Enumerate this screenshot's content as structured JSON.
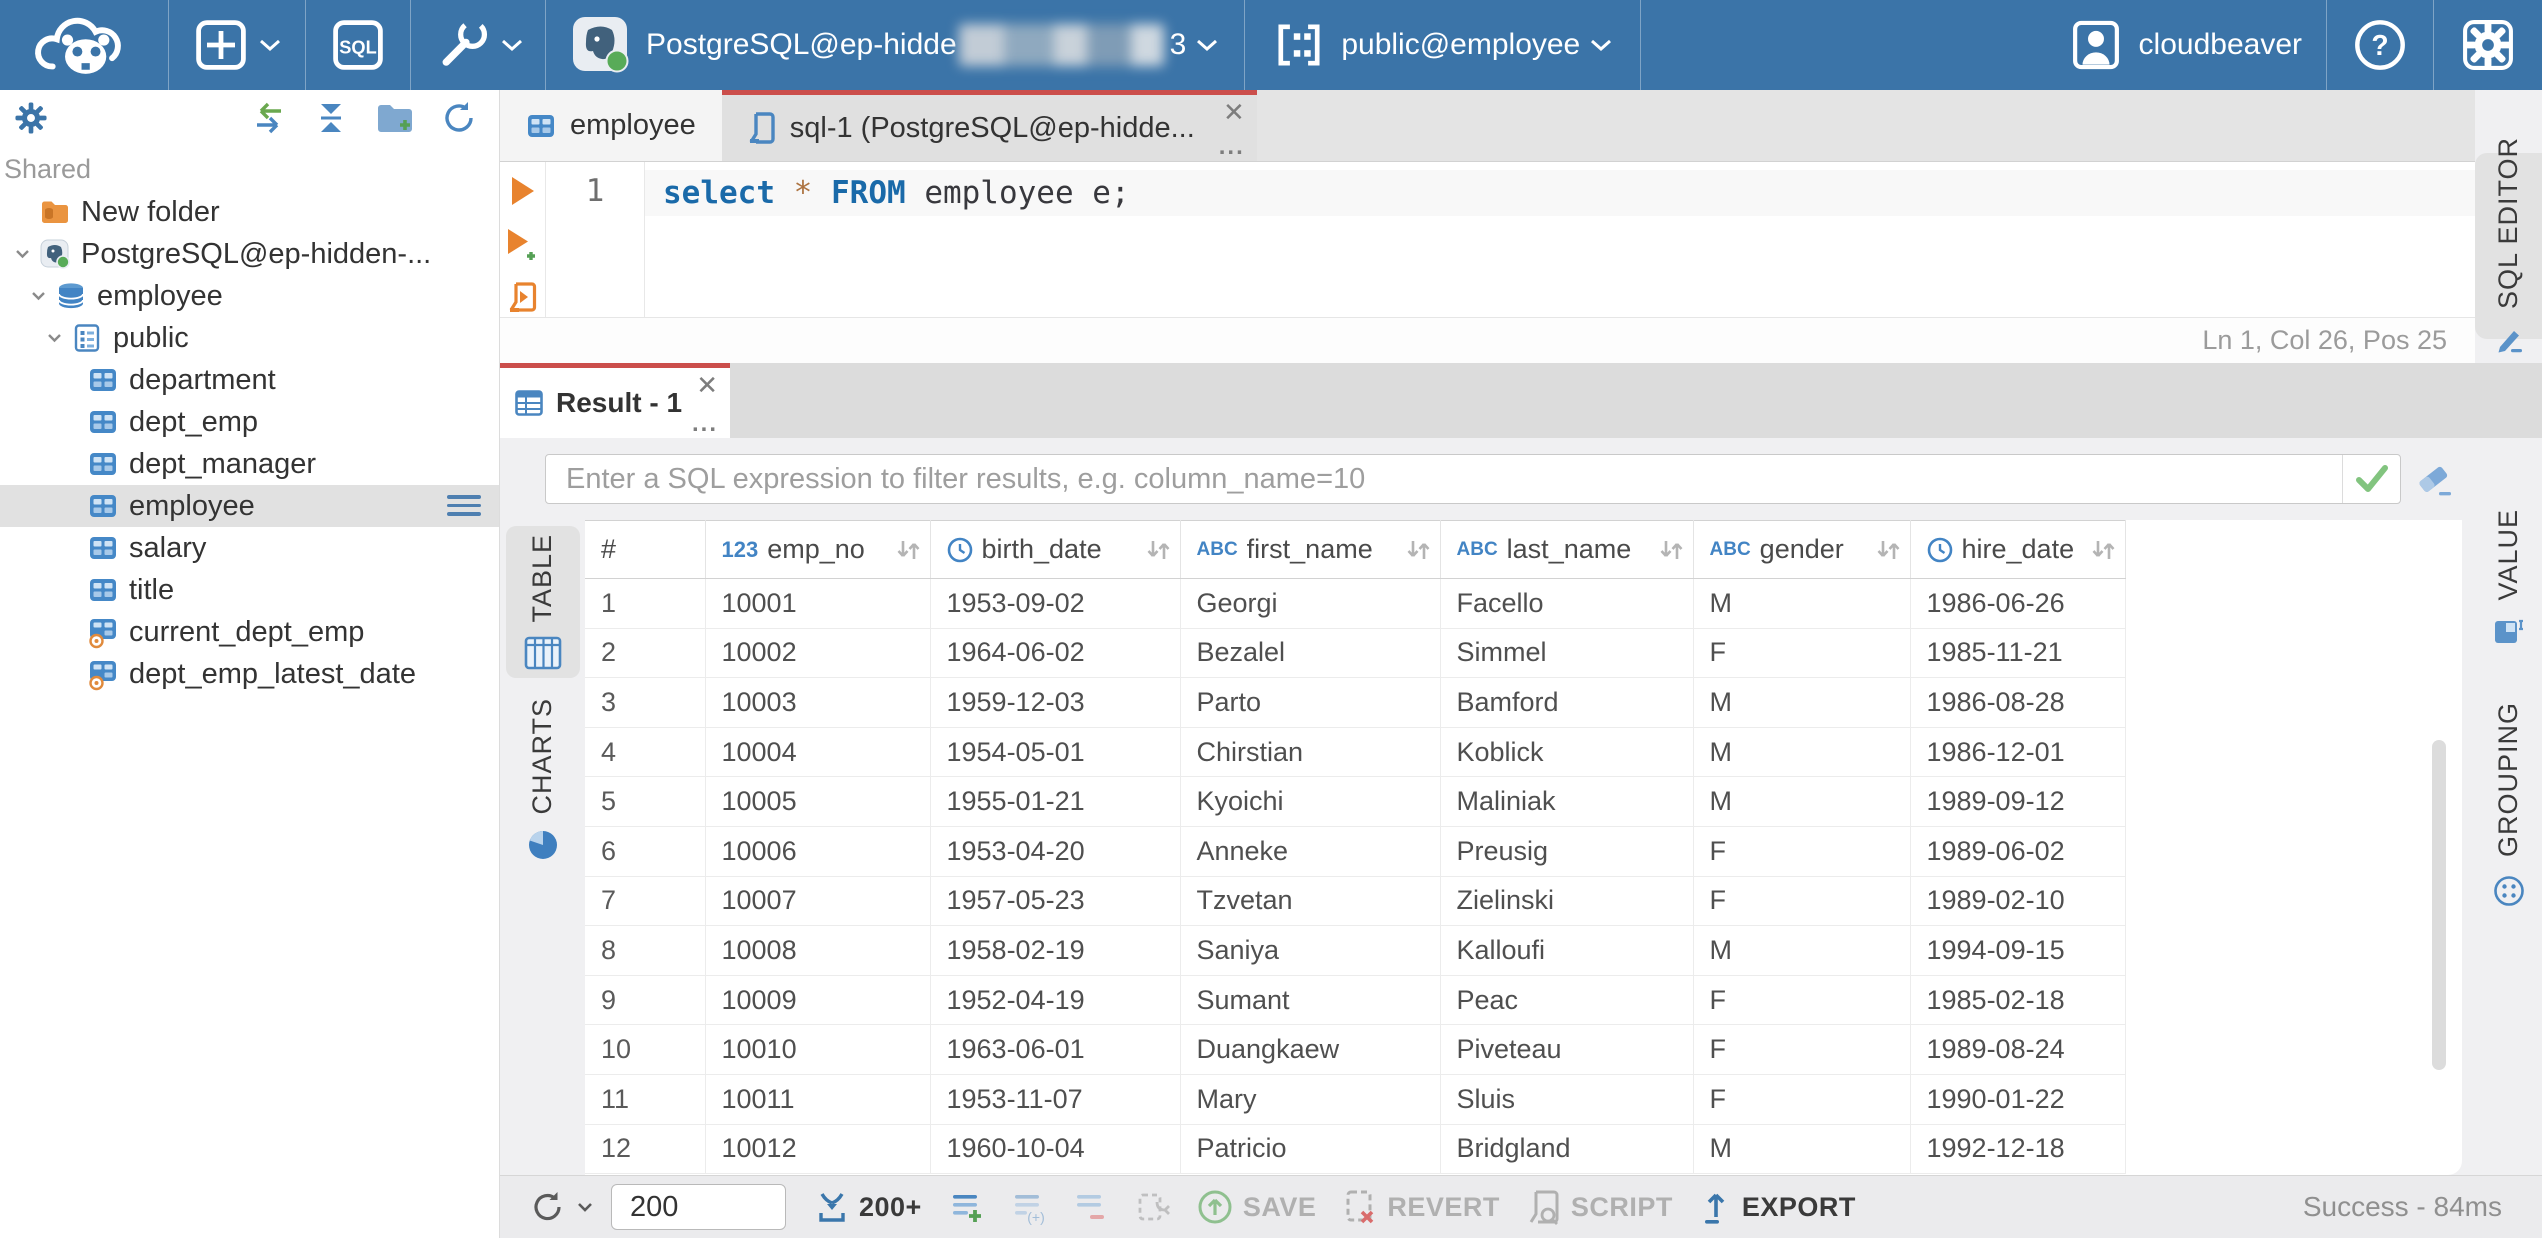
{
  "topbar": {
    "buttons": {
      "sql_label": "SQL"
    },
    "connection": {
      "label": "PostgreSQL@ep-hidde",
      "suffix": "3"
    },
    "schema": {
      "label": "public@employee"
    },
    "user": {
      "name": "cloudbeaver"
    }
  },
  "sidebar": {
    "shared_label": "Shared",
    "tree": [
      {
        "label": "New folder",
        "icon": "folder-db",
        "depth": 0,
        "chevron": false,
        "selected": false
      },
      {
        "label": "PostgreSQL@ep-hidden-...",
        "icon": "postgres",
        "depth": 0,
        "chevron": true,
        "selected": false
      },
      {
        "label": "employee",
        "icon": "database",
        "depth": 1,
        "chevron": true,
        "selected": false
      },
      {
        "label": "public",
        "icon": "schema",
        "depth": 2,
        "chevron": true,
        "selected": false
      },
      {
        "label": "department",
        "icon": "table",
        "depth": 3,
        "chevron": false,
        "selected": false
      },
      {
        "label": "dept_emp",
        "icon": "table",
        "depth": 3,
        "chevron": false,
        "selected": false
      },
      {
        "label": "dept_manager",
        "icon": "table",
        "depth": 3,
        "chevron": false,
        "selected": false
      },
      {
        "label": "employee",
        "icon": "table",
        "depth": 3,
        "chevron": false,
        "selected": true
      },
      {
        "label": "salary",
        "icon": "table",
        "depth": 3,
        "chevron": false,
        "selected": false
      },
      {
        "label": "title",
        "icon": "table",
        "depth": 3,
        "chevron": false,
        "selected": false
      },
      {
        "label": "current_dept_emp",
        "icon": "view",
        "depth": 3,
        "chevron": false,
        "selected": false
      },
      {
        "label": "dept_emp_latest_date",
        "icon": "view",
        "depth": 3,
        "chevron": false,
        "selected": false
      }
    ]
  },
  "editor_tabs": {
    "table_tab": "employee",
    "sql_tab": "sql-1 (PostgreSQL@ep-hidde..."
  },
  "sql_editor": {
    "line_number": "1",
    "tokens": [
      {
        "text": "select",
        "type": "keyword"
      },
      {
        "text": " ",
        "type": "plain"
      },
      {
        "text": "*",
        "type": "operator"
      },
      {
        "text": " ",
        "type": "plain"
      },
      {
        "text": "FROM",
        "type": "keyword"
      },
      {
        "text": " employee e;",
        "type": "plain"
      }
    ],
    "status": "Ln 1, Col 26, Pos 25"
  },
  "result": {
    "tab_label": "Result - 1",
    "filter_placeholder": "Enter a SQL expression to filter results, e.g. column_name=10",
    "left_tabs": [
      {
        "label": "TABLE",
        "icon": "table-grid",
        "active": true
      },
      {
        "label": "CHARTS",
        "icon": "pie-chart",
        "active": false
      }
    ],
    "right_tabs": [
      {
        "label": "SQL EDITOR",
        "icon": "sql-editor",
        "active": true,
        "slot": "rt-sqleditor"
      },
      {
        "label": "VALUE",
        "icon": "value-panel",
        "active": false,
        "slot": "rt-value"
      },
      {
        "label": "GROUPING",
        "icon": "grouping",
        "active": false,
        "slot": "rt-grouping"
      }
    ],
    "grid": {
      "columns": [
        {
          "label": "#",
          "type": "index"
        },
        {
          "label": "emp_no",
          "type": "number"
        },
        {
          "label": "birth_date",
          "type": "datetime"
        },
        {
          "label": "first_name",
          "type": "string"
        },
        {
          "label": "last_name",
          "type": "string"
        },
        {
          "label": "gender",
          "type": "string"
        },
        {
          "label": "hire_date",
          "type": "datetime"
        }
      ],
      "rows": [
        [
          "1",
          "10001",
          "1953-09-02",
          "Georgi",
          "Facello",
          "M",
          "1986-06-26"
        ],
        [
          "2",
          "10002",
          "1964-06-02",
          "Bezalel",
          "Simmel",
          "F",
          "1985-11-21"
        ],
        [
          "3",
          "10003",
          "1959-12-03",
          "Parto",
          "Bamford",
          "M",
          "1986-08-28"
        ],
        [
          "4",
          "10004",
          "1954-05-01",
          "Chirstian",
          "Koblick",
          "M",
          "1986-12-01"
        ],
        [
          "5",
          "10005",
          "1955-01-21",
          "Kyoichi",
          "Maliniak",
          "M",
          "1989-09-12"
        ],
        [
          "6",
          "10006",
          "1953-04-20",
          "Anneke",
          "Preusig",
          "F",
          "1989-06-02"
        ],
        [
          "7",
          "10007",
          "1957-05-23",
          "Tzvetan",
          "Zielinski",
          "F",
          "1989-02-10"
        ],
        [
          "8",
          "10008",
          "1958-02-19",
          "Saniya",
          "Kalloufi",
          "M",
          "1994-09-15"
        ],
        [
          "9",
          "10009",
          "1952-04-19",
          "Sumant",
          "Peac",
          "F",
          "1985-02-18"
        ],
        [
          "10",
          "10010",
          "1963-06-01",
          "Duangkaew",
          "Piveteau",
          "F",
          "1989-08-24"
        ],
        [
          "11",
          "10011",
          "1953-11-07",
          "Mary",
          "Sluis",
          "F",
          "1990-01-22"
        ],
        [
          "12",
          "10012",
          "1960-10-04",
          "Patricio",
          "Bridgland",
          "M",
          "1992-12-18"
        ]
      ]
    }
  },
  "bottom_toolbar": {
    "fetch_size": "200",
    "load_more_label": "200+",
    "save_label": "SAVE",
    "revert_label": "REVERT",
    "script_label": "SCRIPT",
    "export_label": "EXPORT",
    "status": "Success - 84ms"
  },
  "colors": {
    "topbar_blue": "#3b74a8",
    "accent_red": "#cb4e4b",
    "icon_blue": "#4284c4",
    "success_green": "#7dc47d"
  }
}
